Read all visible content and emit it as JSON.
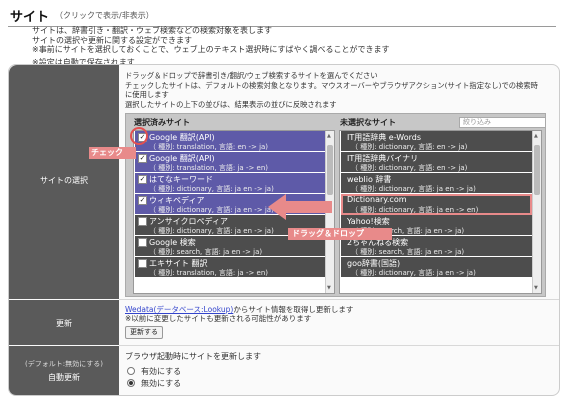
{
  "header": {
    "title": "サイト",
    "subtitle": "（クリックで表示/非表示）"
  },
  "description": [
    "サイトは、辞書引き・翻訳・ウェブ検索などの検索対象を表します",
    "サイトの選択や更新に関する設定ができます",
    "※事前にサイトを選択しておくことで、ウェブ上のテキスト選択時にすばやく調べることができます"
  ],
  "auto_save_note": "※設定は自動で保存されます",
  "site_select": {
    "label": "サイトの選択",
    "intro": [
      "ドラッグ＆ドロップで辞書引き/翻訳/ウェブ検索するサイトを選んでください",
      "チェックしたサイトは、デフォルトの検索対象となります。マウスオーバーやブラウザアクション(サイト指定なし)での検索時",
      "に使用します",
      "選択したサイトの上下の並びは、結果表示の並びに反映されます"
    ],
    "selected_header": "選択済みサイト",
    "unselected_header": "未選択なサイト",
    "filter_placeholder": "絞り込み",
    "selected_items": [
      {
        "name": "Google 翻訳(API)",
        "detail": "（ 種別: translation, 言語: en -> ja)",
        "checked": true
      },
      {
        "name": "Google 翻訳(API)",
        "detail": "（ 種別: translation, 言語: ja -> en)",
        "checked": true
      },
      {
        "name": "はてなキーワード",
        "detail": "（ 種別: dictionary, 言語: ja en -> ja)",
        "checked": true
      },
      {
        "name": "ウィキペディア",
        "detail": "（ 種別: dictionary, 言語: ja en -> ja)",
        "checked": true
      },
      {
        "name": "アンサイクロペディア",
        "detail": "（ 種別: dictionary, 言語: ja en -> ja)",
        "checked": false
      },
      {
        "name": "Google 検索",
        "detail": "（ 種別: search, 言語: ja en -> ja)",
        "checked": false
      },
      {
        "name": "エキサイト 翻訳",
        "detail": "（ 種別: translation, 言語: ja -> en)",
        "checked": false
      }
    ],
    "unselected_items": [
      {
        "name": "IT用語辞典 e-Words",
        "detail": "（ 種別: dictionary, 言語: en -> ja)"
      },
      {
        "name": "IT用語辞典バイナリ",
        "detail": "（ 種別: dictionary, 言語: en -> ja)"
      },
      {
        "name": "weblio 辞書",
        "detail": "（ 種別: dictionary, 言語: ja en -> ja)"
      },
      {
        "name": "Dictionary.com",
        "detail": "（ 種別: dictionary, 言語: ja en -> en)"
      },
      {
        "name": "Yahoo!検索",
        "detail": "（ 種別: search, 言語: ja en -> ja)"
      },
      {
        "name": "2ちゃんねる検索",
        "detail": "（ 種別: search, 言語: ja en -> ja)"
      },
      {
        "name": "goo辞書(国語)",
        "detail": "（ 種別: dictionary, 言語: ja en -> ja)"
      }
    ],
    "callout_check": "チェック",
    "callout_drag": "ドラッグ＆ドロップ"
  },
  "update": {
    "label": "更新",
    "link_text": "Wedata(データベース:Lookup)",
    "link_suffix": "からサイト情報を取得し更新します",
    "note": "※以前に変更したサイトも更新される可能性があります",
    "button": "更新する"
  },
  "auto_update": {
    "label": "自動更新",
    "sublabel": "(デフォルト:無効にする)",
    "title": "ブラウザ起動時にサイトを更新します",
    "options": [
      {
        "label": "有効にする",
        "selected": false
      },
      {
        "label": "無効にする",
        "selected": true
      }
    ]
  },
  "colors": {
    "selected_item": "#5e5aa8",
    "item": "#4d4d4d",
    "annotation": "#e88a8a",
    "label_bg": "#5a5a5a"
  }
}
